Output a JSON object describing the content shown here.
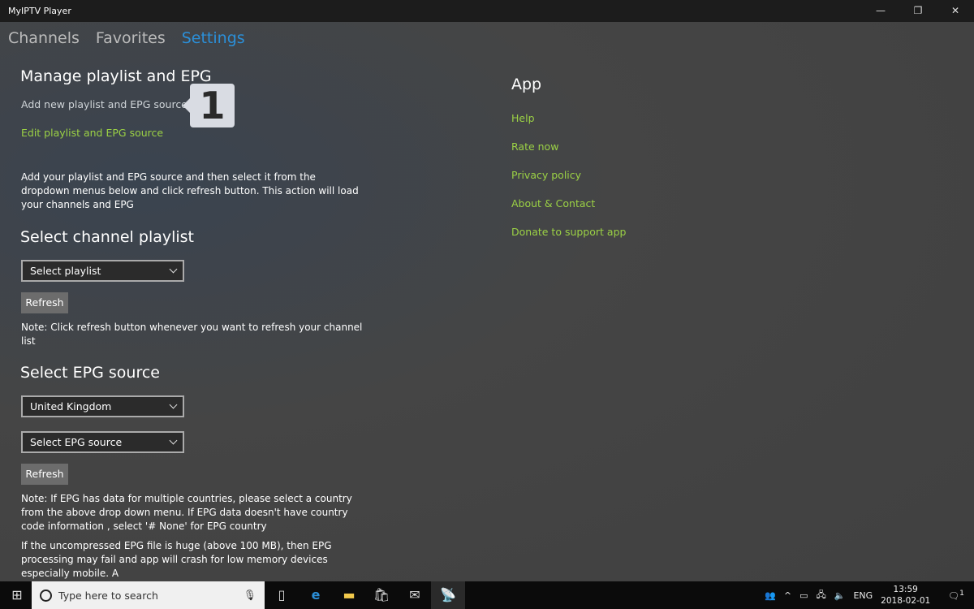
{
  "window": {
    "title": "MyIPTV Player",
    "minimize": "—",
    "restore": "❐",
    "close": "✕"
  },
  "tabs": [
    {
      "label": "Channels"
    },
    {
      "label": "Favorites"
    },
    {
      "label": "Settings",
      "active": true
    }
  ],
  "manage": {
    "heading": "Manage playlist and EPG",
    "add": "Add new playlist and EPG source",
    "edit": "Edit playlist and EPG source",
    "badge": "1",
    "description": "Add your playlist and EPG source and then select it from the dropdown menus below and click refresh button. This action will load your channels and EPG"
  },
  "playlist": {
    "heading": "Select channel playlist",
    "dropdown": "Select playlist",
    "refresh": "Refresh",
    "note": "Note: Click refresh button whenever you want to refresh your channel list"
  },
  "epg": {
    "heading": "Select EPG source",
    "country": "United Kingdom",
    "source": "Select EPG source",
    "refresh": "Refresh",
    "note1": "Note:  If EPG has data for multiple countries, please select a country from the above drop down menu. If EPG  data doesn't have country code information , select '# None' for EPG country",
    "note2": "If the uncompressed EPG file is huge (above 100 MB), then EPG processing may fail and app will crash for low memory devices especially mobile. A"
  },
  "app": {
    "heading": "App",
    "links": [
      "Help",
      "Rate now",
      "Privacy policy",
      "About & Contact",
      "Donate to support app"
    ]
  },
  "taskbar": {
    "search_placeholder": "Type here to search",
    "time": "13:59",
    "date": "2018-02-01",
    "lang": "ENG",
    "notifications": "1"
  },
  "colors": {
    "accent": "#2b8fd8",
    "link": "#9bd145"
  }
}
